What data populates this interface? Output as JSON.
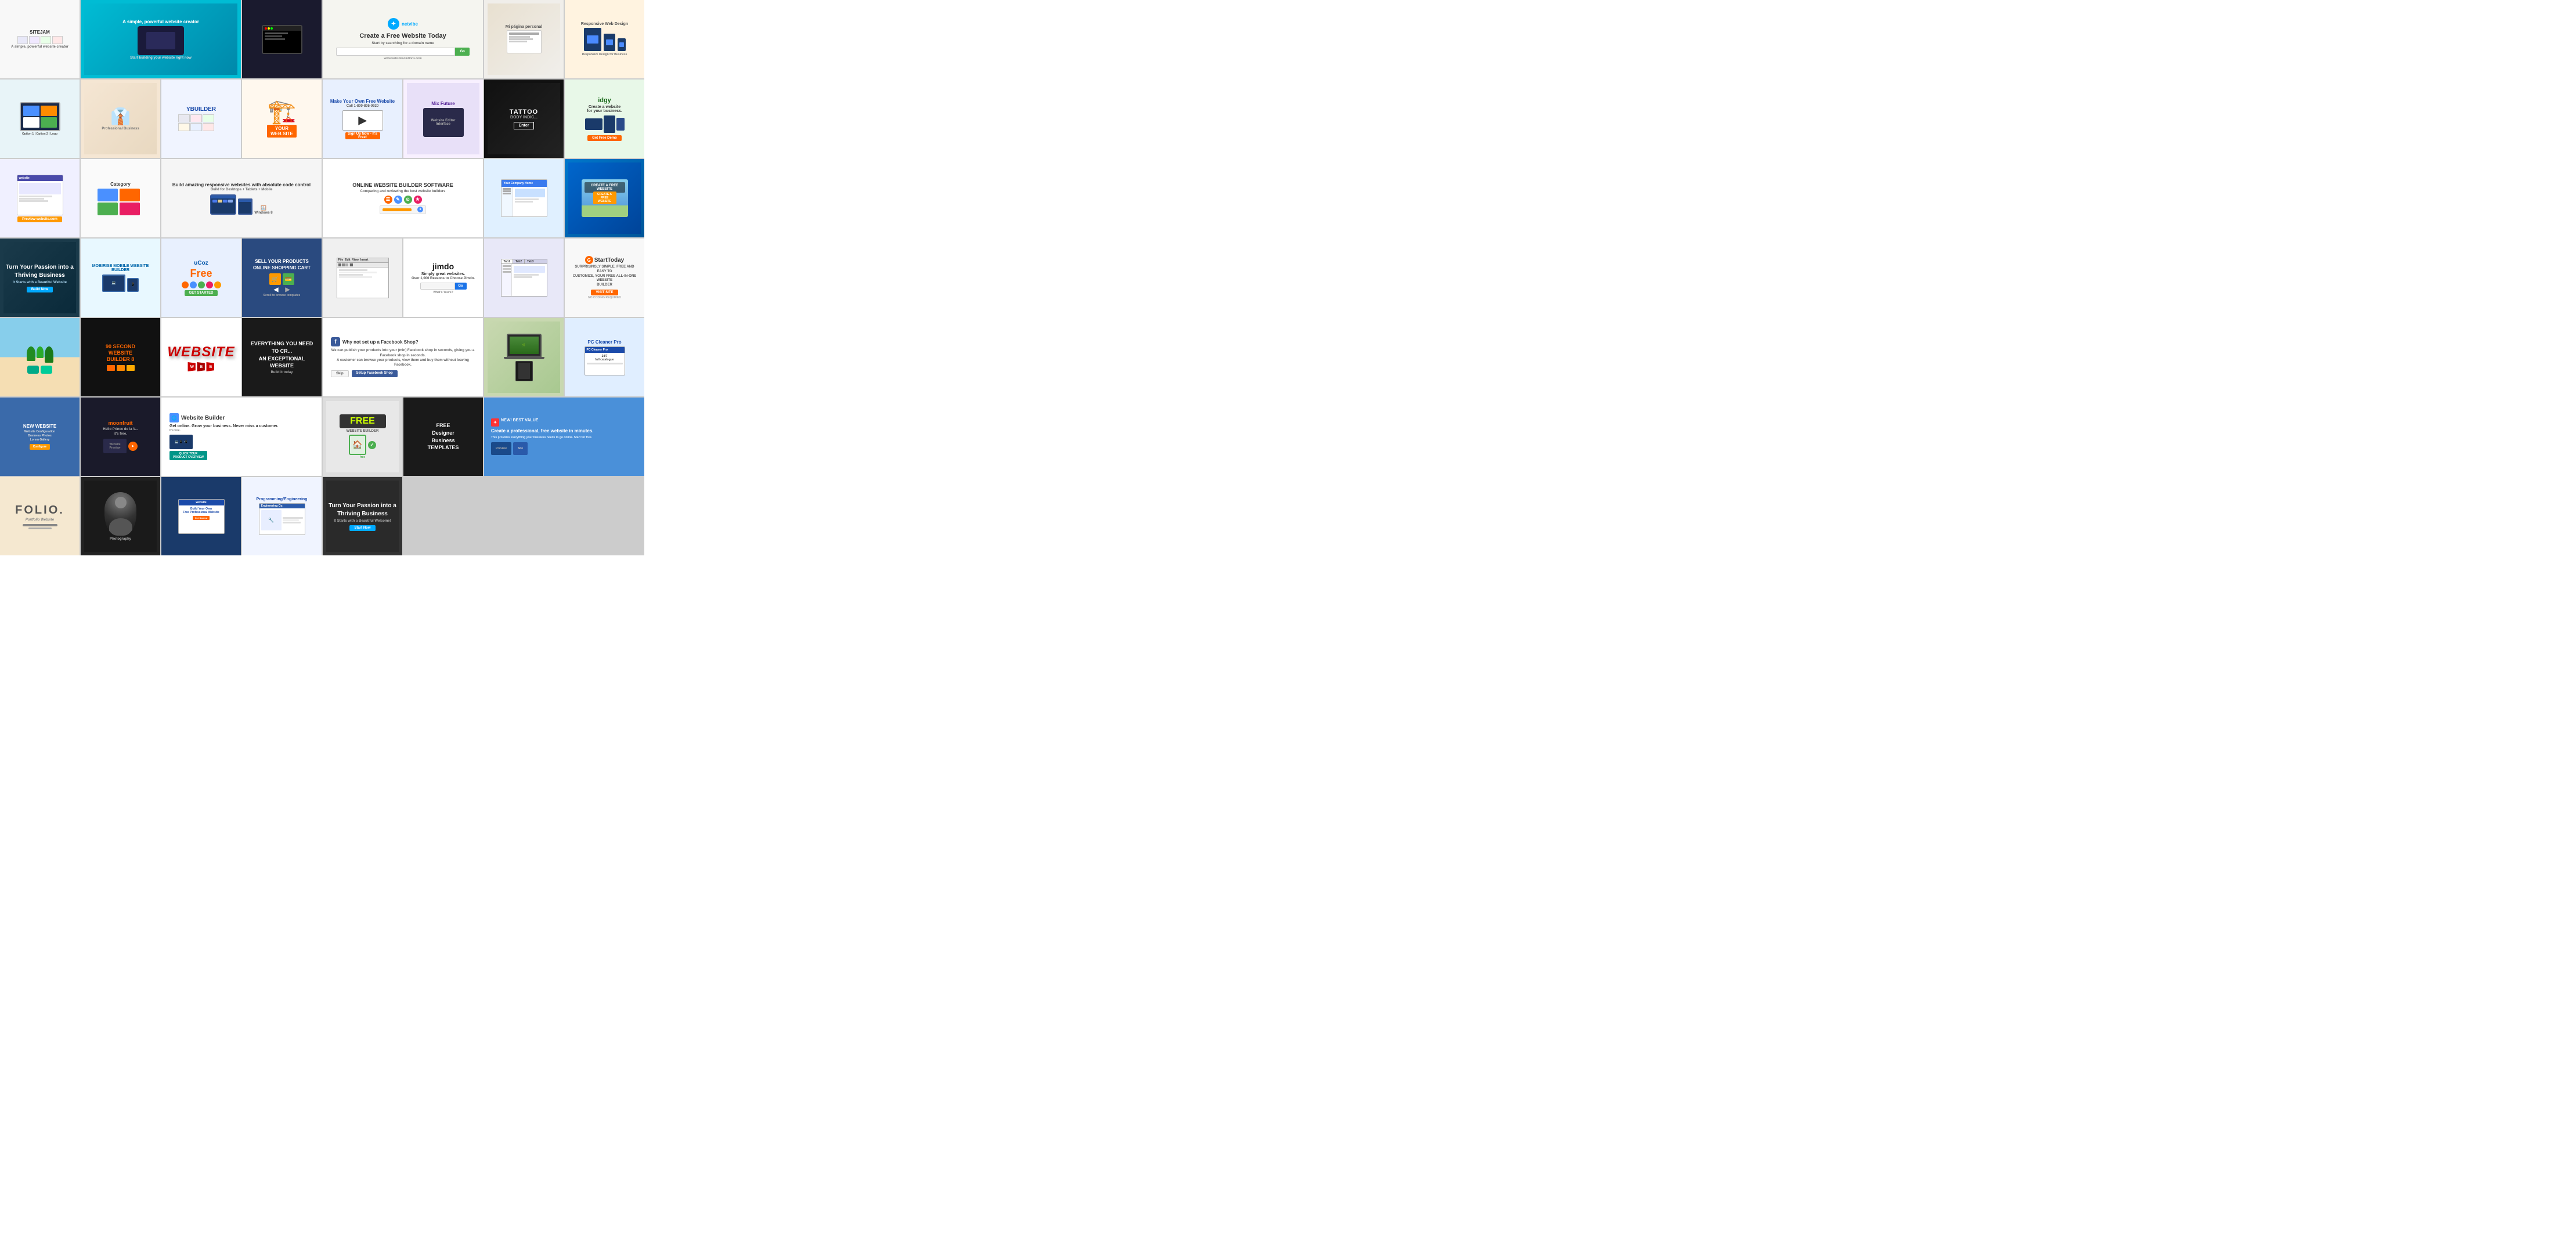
{
  "tiles": {
    "row1": [
      {
        "id": "sitejam",
        "label": "SITEJAM",
        "sub": "A simple, powerful website creator",
        "bg": "#f8f8f8",
        "color": "#333"
      },
      {
        "id": "sitepal",
        "label": "A simple, powerful website creator",
        "sub": "",
        "bg": "#00bcd4",
        "color": "#fff"
      },
      {
        "id": "darkscreen",
        "label": "",
        "sub": "",
        "bg": "#1a1a2e",
        "color": "#fff"
      },
      {
        "id": "create-free",
        "label": "Create a Free Website Today",
        "sub": "Start by searching for a domain name",
        "bg": "#f5f5f0",
        "color": "#333"
      },
      {
        "id": "mipagina",
        "label": "Mi página personal",
        "sub": "",
        "bg": "#f0eeea",
        "color": "#555"
      },
      {
        "id": "responsive",
        "label": "Responsive Web Design for Business",
        "sub": "",
        "bg": "#fff3e0",
        "color": "#333"
      },
      {
        "id": "monitor-blue",
        "label": "",
        "sub": "",
        "bg": "#e8f4f8",
        "color": "#333"
      },
      {
        "id": "suit-man",
        "label": "",
        "sub": "",
        "bg": "#f5e6d3",
        "color": "#333"
      }
    ],
    "row2": [
      {
        "id": "yola",
        "label": "YBUILDER",
        "sub": "",
        "bg": "#f0f4ff",
        "color": "#333"
      },
      {
        "id": "builder-man",
        "label": "YOUR WEB SITE",
        "sub": "",
        "bg": "#fff8ee",
        "color": "#555"
      },
      {
        "id": "make-own",
        "label": "Make Your Own Free Website",
        "sub": "Call 1-800-805-0920",
        "bg": "#e8f0fe",
        "color": "#333"
      },
      {
        "id": "mix-future",
        "label": "Mix Future",
        "sub": "",
        "bg": "#f8f0ff",
        "color": "#333"
      },
      {
        "id": "tattoo",
        "label": "TATTOO BODY INDIC...",
        "sub": "Enter",
        "bg": "#111",
        "color": "#fff"
      },
      {
        "id": "idgy",
        "label": "idgy",
        "sub": "Create a website for your business.",
        "bg": "#e8f8e8",
        "color": "#333"
      },
      {
        "id": "preview",
        "label": "website",
        "sub": "Preview-website.com",
        "bg": "#f0f0ff",
        "color": "#333"
      },
      {
        "id": "category",
        "label": "Category",
        "sub": "",
        "bg": "#fafafa",
        "color": "#555"
      }
    ],
    "row3": [
      {
        "id": "nocode",
        "label": "Build amazing responsive websites with absolute code control",
        "sub": "Build for Desktops + Tablets + Mobile",
        "bg": "#f5f5f5",
        "color": "#333"
      },
      {
        "id": "online-builder",
        "label": "ONLINE WEBSITE BUILDER SOFTWARE",
        "sub": "Comparing and reviewing the best website builders",
        "bg": "#fff",
        "color": "#333"
      },
      {
        "id": "company-site",
        "label": "Your Company Name",
        "sub": "",
        "bg": "#e0f0ff",
        "color": "#333"
      },
      {
        "id": "create-free2",
        "label": "CREATE A FREE WEBSITE",
        "sub": "",
        "bg": "#007bff",
        "color": "#fff"
      },
      {
        "id": "thriving",
        "label": "Turn Your Passion into a Thriving Business",
        "sub": "It Starts with a Beautiful Website",
        "bg": "#1a3a4a",
        "color": "#fff"
      },
      {
        "id": "mobirise",
        "label": "MOBIRISE MOBILE WEBSITE BUILDER",
        "sub": "",
        "bg": "#e8f8ff",
        "color": "#333"
      },
      {
        "id": "ucoz",
        "label": "Free",
        "sub": "GET STARTED",
        "bg": "#e8f0fe",
        "color": "#333"
      },
      {
        "id": "sell-prod",
        "label": "SELL YOUR PRODUCTS ONLINE SHOPPING CART",
        "sub": "",
        "bg": "#2a4a7f",
        "color": "#fff"
      }
    ],
    "row4": [
      {
        "id": "editor",
        "label": "File Edit View Insert Format Tools Table Help",
        "sub": "",
        "bg": "#f0f0f0",
        "color": "#333"
      },
      {
        "id": "jimdo",
        "label": "jimdo",
        "sub": "Simply great websites. Over 1,000 Reasons to Choose Jimdo.",
        "bg": "#fff",
        "color": "#333"
      },
      {
        "id": "tabs-editor",
        "label": "",
        "sub": "",
        "bg": "#e8e8f8",
        "color": "#333"
      },
      {
        "id": "start-today",
        "label": "StartToday",
        "sub": "SURPRISINGLY SIMPLE, FREE AND EASY TO CUSTOMIZE",
        "bg": "#f8f8f8",
        "color": "#333"
      },
      {
        "id": "beach-scene",
        "label": "",
        "sub": "",
        "bg": "#87ceeb",
        "color": "#333"
      },
      {
        "id": "90sec",
        "label": "90 SECOND WEBSITE BUILDER 8",
        "sub": "",
        "bg": "#111",
        "color": "#fff"
      },
      {
        "id": "website3d",
        "label": "WEBSITE",
        "sub": "",
        "bg": "#fff",
        "color": "#cc0000"
      },
      {
        "id": "exceptional",
        "label": "EVERYTHING YOU NEED TO CREATE AN EXCEPTIONAL WEBSITE",
        "sub": "",
        "bg": "#1a1a1a",
        "color": "#fff"
      }
    ],
    "row5": [
      {
        "id": "fbshop",
        "label": "Why not set up a Facebook Shop?",
        "sub": "We can publish your products into your (min) Facebook shop in seconds.",
        "bg": "#fff",
        "color": "#333"
      },
      {
        "id": "laptop-scene",
        "label": "",
        "sub": "",
        "bg": "#c8d8b0",
        "color": "#333"
      },
      {
        "id": "pccleaner",
        "label": "PC Cleaner Pro",
        "sub": "24/7 full catalogue",
        "bg": "#e0eeff",
        "color": "#333"
      },
      {
        "id": "newsite",
        "label": "NEW WEBSITE",
        "sub": "Website Configuration, Business Photos, Lorem Gallery",
        "bg": "#3a6aaa",
        "color": "#fff"
      },
      {
        "id": "moonfruit",
        "label": "moonfruit",
        "sub": "Hello Prince de la V... it's free.",
        "bg": "#1a1a2a",
        "color": "#ccc"
      },
      {
        "id": "ws-builder",
        "label": "Website Builder",
        "sub": "Get online. Grow your business. Never miss a customer.",
        "bg": "#fff",
        "color": "#333"
      },
      {
        "id": "free-builder",
        "label": "FREE WEBSITE BUILDER",
        "sub": "free",
        "bg": "#ddd",
        "color": "#555"
      }
    ],
    "row6": [
      {
        "id": "free-designer",
        "label": "FREE Designer Business TEMPLATES",
        "sub": "",
        "bg": "#1a1a1a",
        "color": "#fff"
      },
      {
        "id": "fb-pro",
        "label": "Create a professional, free website in minutes.",
        "sub": "This provides everything your business needs to go online. Start for free.",
        "bg": "#4a90d9",
        "color": "#fff"
      },
      {
        "id": "folio",
        "label": "FOLIO.",
        "sub": "",
        "bg": "#f5e8d0",
        "color": "#555"
      },
      {
        "id": "dark-person",
        "label": "",
        "sub": "",
        "bg": "#222",
        "color": "#fff"
      },
      {
        "id": "build-own",
        "label": "Build Your Own Free Professional Website",
        "sub": "",
        "bg": "#1a3a6a",
        "color": "#fff"
      },
      {
        "id": "programming",
        "label": "Programming/Engineering",
        "sub": "",
        "bg": "#f0f4ff",
        "color": "#333"
      },
      {
        "id": "thriving2",
        "label": "Turn Your Passion into a Thriving Business",
        "sub": "It Starts with a Beautiful Welcome!",
        "bg": "#333",
        "color": "#fff"
      }
    ]
  },
  "colors": {
    "grid_gap": "#cccccc",
    "accent_green": "#4caf50",
    "accent_blue": "#1a73e8",
    "accent_orange": "#ff6600",
    "accent_cyan": "#00bcd4",
    "accent_teal": "#009688"
  }
}
